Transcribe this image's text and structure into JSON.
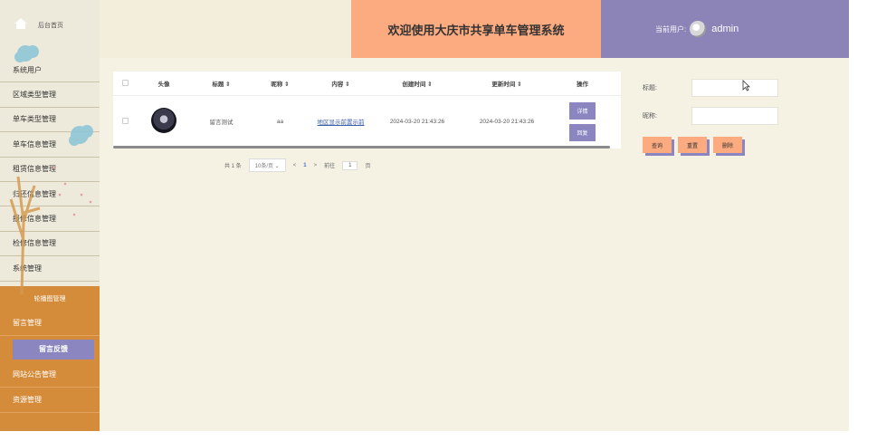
{
  "header": {
    "title": "欢迎使用大庆市共享单车管理系统",
    "current_user_label": "当前用户:",
    "username": "admin"
  },
  "sidebar": {
    "home_label": "后台首页",
    "items": [
      {
        "label": "系统用户"
      },
      {
        "label": "区域类型管理"
      },
      {
        "label": "单车类型管理"
      },
      {
        "label": "单车信息管理"
      },
      {
        "label": "租赁信息管理"
      },
      {
        "label": "归还信息管理"
      },
      {
        "label": "报修信息管理"
      },
      {
        "label": "检修信息管理"
      },
      {
        "label": "系统管理"
      },
      {
        "label": "轮播图管理"
      },
      {
        "label": "留言管理"
      },
      {
        "label": "留言反馈"
      },
      {
        "label": "网站公告管理"
      },
      {
        "label": "资源管理"
      }
    ]
  },
  "table": {
    "columns": [
      "头像",
      "标题 ⇕",
      "昵称 ⇕",
      "内容 ⇕",
      "创建时间 ⇕",
      "更新时间 ⇕",
      "操作"
    ],
    "rows": [
      {
        "title": "留言测试",
        "nickname": "aa",
        "content": "地区显示前置示前",
        "created": "2024-03-20 21:43:26",
        "updated": "2024-03-20 21:43:26",
        "detail_label": "详情",
        "reply_label": "回复"
      }
    ]
  },
  "pagination": {
    "total": "共 1 条",
    "page_size": "10条/页",
    "prev": "<",
    "page": "1",
    "next": ">",
    "goto_label": "前往",
    "goto_value": "1",
    "page_suffix": "页"
  },
  "search": {
    "title_label": "标题:",
    "title_value": "",
    "nickname_label": "昵称:",
    "nickname_value": "",
    "query_label": "查询",
    "reset_label": "重置",
    "delete_label": "删除"
  },
  "colors": {
    "header_orange": "#fcaa7f",
    "header_purple": "#8c84b6",
    "sidebar_orange": "#d58c3a",
    "active_purple": "#8b86c0",
    "background": "#f5f2e4"
  }
}
